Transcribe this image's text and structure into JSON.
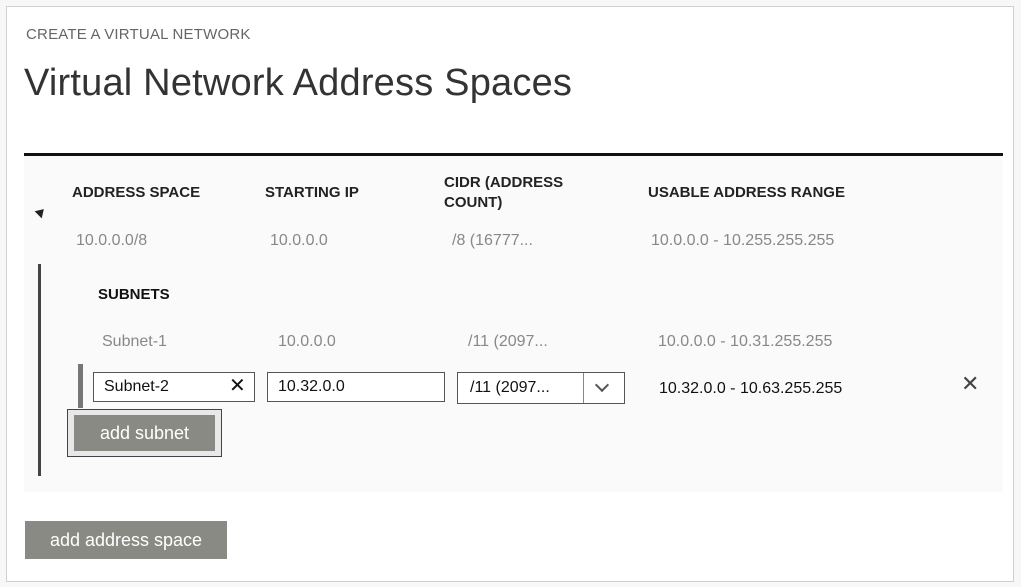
{
  "header": {
    "wizard_label": "CREATE A VIRTUAL NETWORK",
    "title": "Virtual Network Address Spaces"
  },
  "table": {
    "columns": [
      "ADDRESS SPACE",
      "STARTING IP",
      "CIDR (ADDRESS",
      "COUNT)",
      "USABLE ADDRESS RANGE"
    ],
    "address_space": {
      "address": "10.0.0.0/8",
      "starting_ip": "10.0.0.0",
      "cidr": "/8 (16777...",
      "usable_range": "10.0.0.0 - 10.255.255.255"
    },
    "subnets_label": "SUBNETS",
    "subnets": [
      {
        "name": "Subnet-1",
        "starting_ip": "10.0.0.0",
        "cidr": "/11 (2097...",
        "usable_range": "10.0.0.0 - 10.31.255.255"
      }
    ],
    "edit_row": {
      "name": "Subnet-2",
      "starting_ip": "10.32.0.0",
      "cidr": "/11 (2097...",
      "usable_range": "10.32.0.0 - 10.63.255.255",
      "clear_icon": "close-icon",
      "delete_icon": "close-icon",
      "dropdown_icon": "chevron-down-icon"
    }
  },
  "buttons": {
    "add_subnet": "add subnet",
    "add_address_space": "add address space"
  },
  "colors": {
    "button_bg": "#8a8a84",
    "rule": "#111111"
  }
}
